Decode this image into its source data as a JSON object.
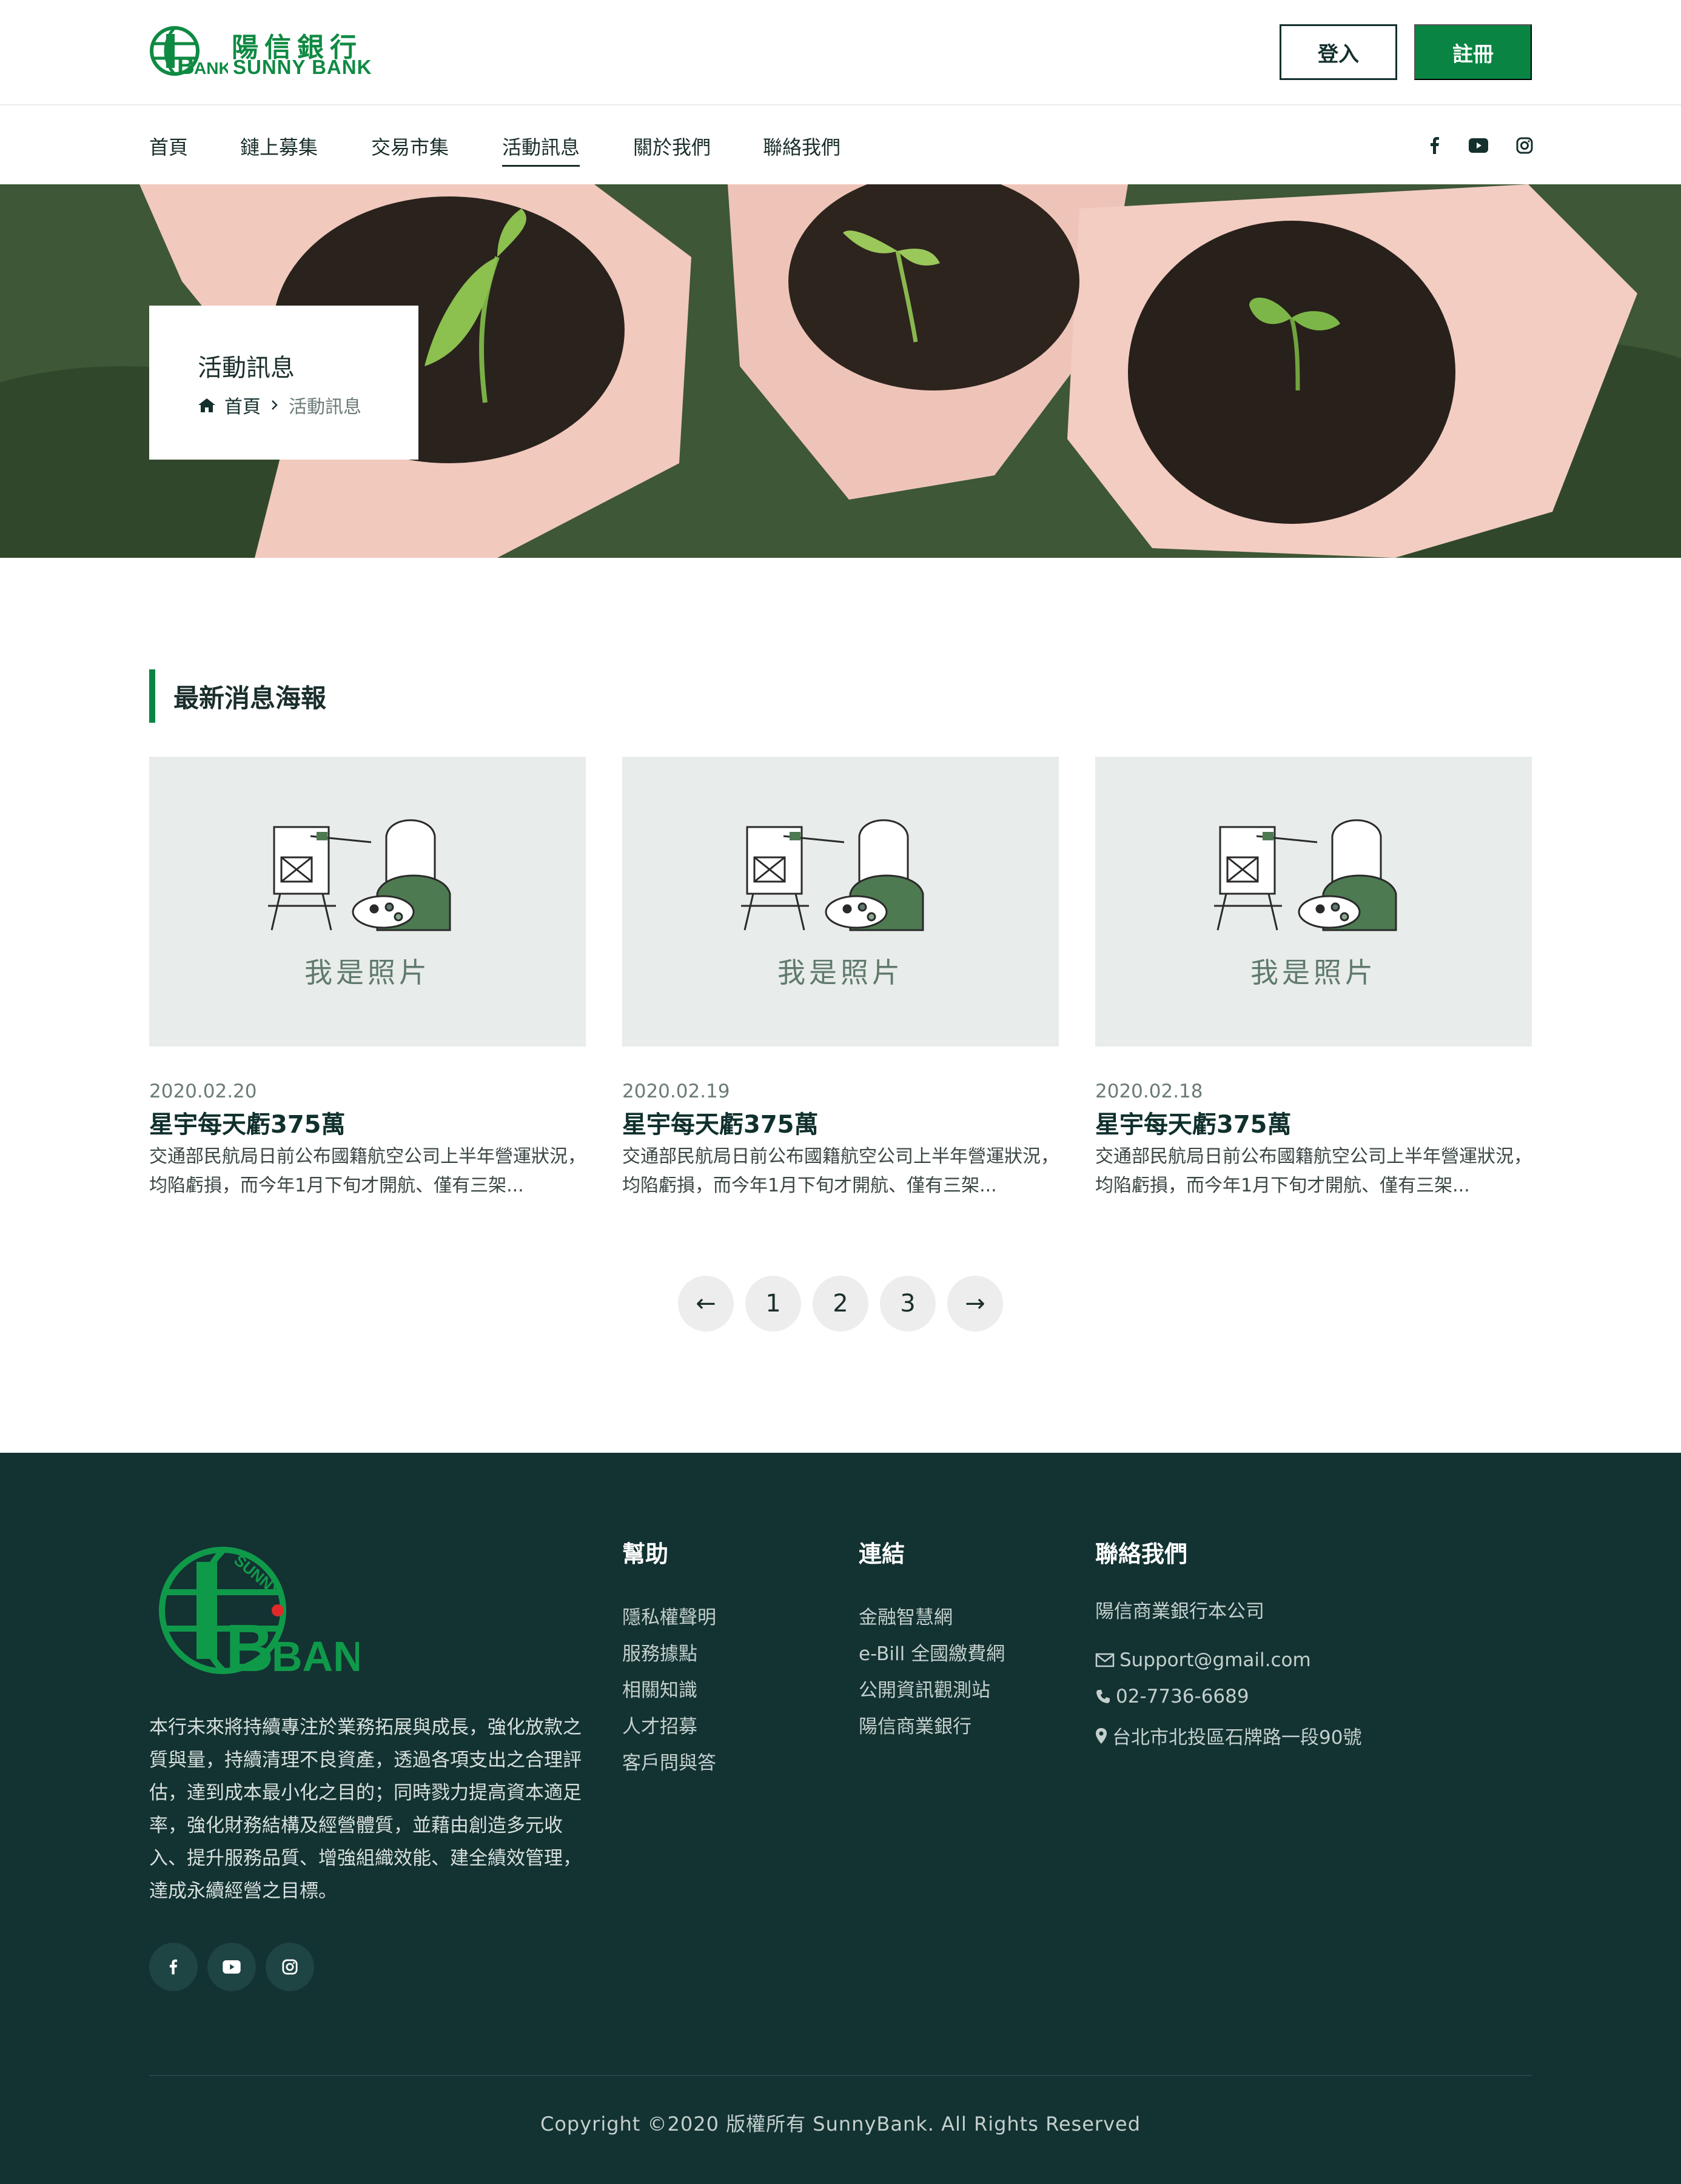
{
  "header": {
    "logo_cn": "陽信銀行",
    "logo_en": "SUNNY BANK",
    "login_label": "登入",
    "register_label": "註冊"
  },
  "nav": {
    "items": [
      {
        "label": "首頁"
      },
      {
        "label": "鏈上募集"
      },
      {
        "label": "交易市集"
      },
      {
        "label": "活動訊息"
      },
      {
        "label": "關於我們"
      },
      {
        "label": "聯絡我們"
      }
    ],
    "active": "活動訊息",
    "social": [
      "facebook-icon",
      "youtube-icon",
      "instagram-icon"
    ]
  },
  "hero": {
    "title": "活動訊息",
    "breadcrumb_home": "首頁",
    "breadcrumb_current": "活動訊息"
  },
  "section": {
    "title": "最新消息海報"
  },
  "cards": [
    {
      "image_label": "我是照片",
      "date": "2020.02.20",
      "title": "星宇每天虧375萬",
      "desc": "交通部民航局日前公布國籍航空公司上半年營運狀況，均陷虧損，而今年1月下旬才開航、僅有三架..."
    },
    {
      "image_label": "我是照片",
      "date": "2020.02.19",
      "title": "星宇每天虧375萬",
      "desc": "交通部民航局日前公布國籍航空公司上半年營運狀況，均陷虧損，而今年1月下旬才開航、僅有三架..."
    },
    {
      "image_label": "我是照片",
      "date": "2020.02.18",
      "title": "星宇每天虧375萬",
      "desc": "交通部民航局日前公布國籍航空公司上半年營運狀況，均陷虧損，而今年1月下旬才開航、僅有三架..."
    }
  ],
  "pagination": {
    "prev": "←",
    "pages": [
      "1",
      "2",
      "3"
    ],
    "next": "→"
  },
  "footer": {
    "logo_sunny": "SUNNY",
    "logo_bank": "BANK",
    "about": "本行未來將持續專注於業務拓展與成長，強化放款之質與量，持續清理不良資產，透過各項支出之合理評估，達到成本最小化之目的；同時戮力提高資本適足率，強化財務結構及經營體質，並藉由創造多元收入、提升服務品質、增強組織效能、建全績效管理，達成永續經營之目標。",
    "help": {
      "heading": "幫助",
      "links": [
        "隱私權聲明",
        "服務據點",
        "相關知識",
        "人才招募",
        "客戶問與答"
      ]
    },
    "links": {
      "heading": "連結",
      "links": [
        "金融智慧網",
        "e-Bill 全國繳費網",
        "公開資訊觀測站",
        "陽信商業銀行"
      ]
    },
    "contact": {
      "heading": "聯絡我們",
      "company": "陽信商業銀行本公司",
      "email": "Support@gmail.com",
      "phone": "02-7736-6689",
      "address": "台北市北投區石牌路一段90號"
    },
    "copyright": "Copyright ©2020 版權所有 SunnyBank. All Rights Reserved"
  },
  "colors": {
    "brand_green": "#0a8443",
    "footer_bg": "#133232",
    "card_bg": "#e8ecea"
  }
}
